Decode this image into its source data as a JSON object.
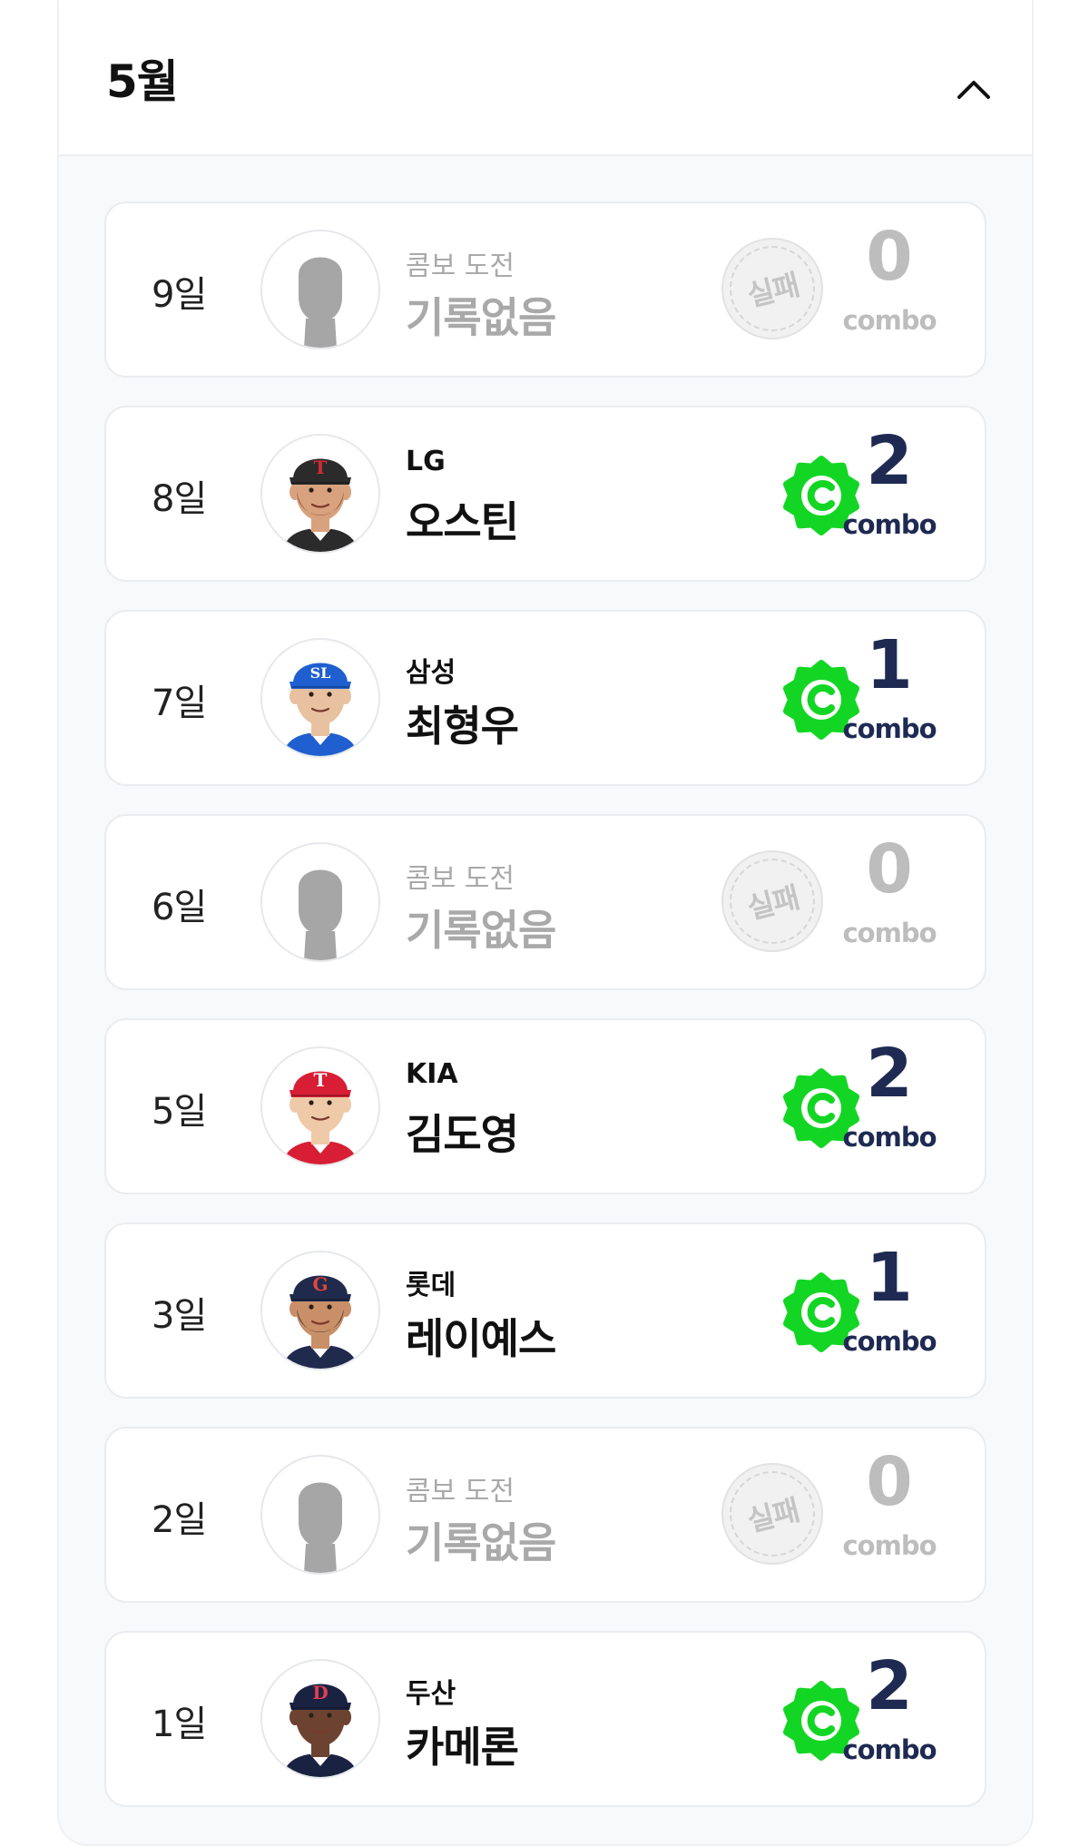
{
  "header": {
    "month_title": "5월"
  },
  "combo_word": "combo",
  "rows": [
    {
      "day": "9일",
      "status": "empty",
      "team": "콤보 도전",
      "name": "기록없음",
      "fail_label": "실패",
      "combo": "0"
    },
    {
      "day": "8일",
      "status": "success",
      "team": "LG",
      "name": "오스틴",
      "combo": "2",
      "cap_color": "#2b2b2b",
      "cap_logo": "T",
      "logo_color": "#d12b3a",
      "skin": "#d9a27e",
      "hair": "#7a4a2c",
      "beard": true
    },
    {
      "day": "7일",
      "status": "success",
      "team": "삼성",
      "name": "최형우",
      "combo": "1",
      "cap_color": "#1f5fcf",
      "cap_logo": "SL",
      "logo_color": "#ffffff",
      "skin": "#e8c2a0",
      "hair": "#2a2a2a",
      "beard": false
    },
    {
      "day": "6일",
      "status": "empty",
      "team": "콤보 도전",
      "name": "기록없음",
      "fail_label": "실패",
      "combo": "0"
    },
    {
      "day": "5일",
      "status": "success",
      "team": "KIA",
      "name": "김도영",
      "combo": "2",
      "cap_color": "#d71e35",
      "cap_logo": "T",
      "logo_color": "#ffffff",
      "skin": "#efcaa8",
      "hair": "#1f1f1f",
      "beard": false
    },
    {
      "day": "3일",
      "status": "success",
      "team": "롯데",
      "name": "레이예스",
      "combo": "1",
      "cap_color": "#1f2a4d",
      "cap_logo": "G",
      "logo_color": "#e2473a",
      "skin": "#c98f68",
      "hair": "#2b2b2b",
      "beard": true
    },
    {
      "day": "2일",
      "status": "empty",
      "team": "콤보 도전",
      "name": "기록없음",
      "fail_label": "실패",
      "combo": "0"
    },
    {
      "day": "1일",
      "status": "success",
      "team": "두산",
      "name": "카메론",
      "combo": "2",
      "cap_color": "#1a2242",
      "cap_logo": "D",
      "logo_color": "#e04050",
      "skin": "#6b4330",
      "hair": "#1a1a1a",
      "beard": false
    }
  ],
  "colors": {
    "badge_green": "#13d624",
    "combo_navy": "#1e2a52",
    "placeholder_gray": "#a6a6a6"
  },
  "icons": {
    "collapse": "chevron-up-icon",
    "badge": "c-check-badge-icon",
    "placeholder": "person-silhouette-icon"
  }
}
